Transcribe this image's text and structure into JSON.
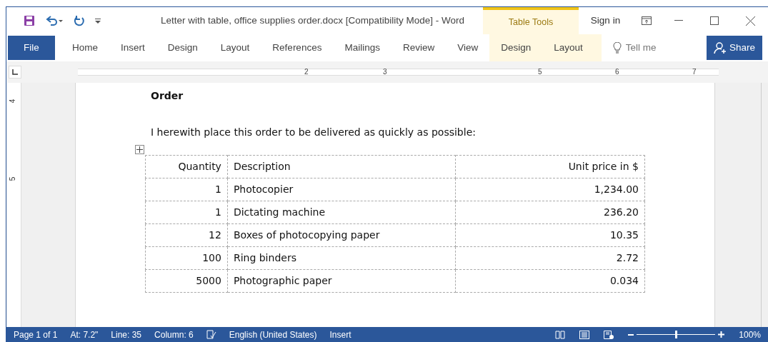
{
  "window": {
    "title": "Letter with table, office supplies order.docx [Compatibility Mode] - Word",
    "context_tab": "Table Tools",
    "sign_in": "Sign in"
  },
  "ribbon_tabs": [
    {
      "label": "File",
      "kind": "file",
      "selected": false
    },
    {
      "label": "Home",
      "kind": "tab",
      "selected": false
    },
    {
      "label": "Insert",
      "kind": "tab",
      "selected": false
    },
    {
      "label": "Design",
      "kind": "tab",
      "selected": false
    },
    {
      "label": "Layout",
      "kind": "tab",
      "selected": false
    },
    {
      "label": "References",
      "kind": "tab",
      "selected": false
    },
    {
      "label": "Mailings",
      "kind": "tab",
      "selected": false
    },
    {
      "label": "Review",
      "kind": "tab",
      "selected": false
    },
    {
      "label": "View",
      "kind": "tab",
      "selected": false
    },
    {
      "label": "Design",
      "kind": "context",
      "selected": false
    },
    {
      "label": "Layout",
      "kind": "context",
      "selected": false
    }
  ],
  "tell_me": {
    "placeholder": "Tell me"
  },
  "share_button": "Share",
  "ruler": {
    "labels": [
      "2",
      "3",
      "5",
      "6",
      "7"
    ],
    "vertical_labels": [
      "4",
      "5"
    ]
  },
  "document": {
    "heading": "Order",
    "paragraph": "I herewith place this order to be delivered as quickly as possible:",
    "table": {
      "columns": [
        "Quantity",
        "Description",
        "Unit price in $"
      ],
      "rows": [
        [
          "1",
          "Photocopier",
          "1,234.00"
        ],
        [
          "1",
          "Dictating machine",
          "236.20"
        ],
        [
          "12",
          "Boxes of photocopying paper",
          "10.35"
        ],
        [
          "100",
          "Ring binders",
          "2.72"
        ],
        [
          "5000",
          "Photographic paper",
          "0.034"
        ]
      ]
    }
  },
  "status_bar": {
    "items": [
      "Page 1 of 1",
      "At: 7.2\"",
      "Line: 35",
      "Column: 6"
    ],
    "language": "English (United States)",
    "mode": "Insert",
    "zoom": {
      "level": 0.5,
      "reading": "100%"
    }
  }
}
